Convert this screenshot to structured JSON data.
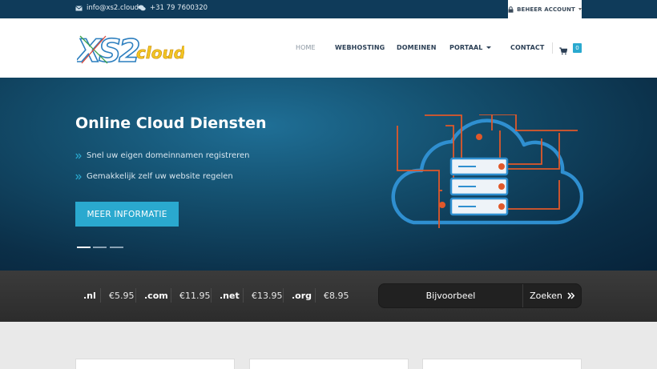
{
  "topbar": {
    "email": "info@xs2.cloud",
    "phone": "+31 79 7600320",
    "account_label": "BEHEER ACCOUNT"
  },
  "logo": {
    "text_main": "XS2",
    "text_sub": "cloud"
  },
  "nav": {
    "items": [
      {
        "label": "HOME",
        "active": true
      },
      {
        "label": "WEBHOSTING"
      },
      {
        "label": "DOMEINEN"
      },
      {
        "label": "PORTAAL",
        "has_dropdown": true
      },
      {
        "label": "CONTACT"
      }
    ],
    "cart_count": "0"
  },
  "hero": {
    "title": "Online Cloud Diensten",
    "bullets": [
      "Snel uw eigen domeinnamen registreren",
      "Gemakkelijk zelf uw website regelen"
    ],
    "cta_label": "MEER INFORMATIE",
    "slide_count": 3,
    "active_slide": 1
  },
  "domains": {
    "tlds": [
      {
        "tld": ".nl",
        "price": "€5.95"
      },
      {
        "tld": ".com",
        "price": "€11.95"
      },
      {
        "tld": ".net",
        "price": "€13.95"
      },
      {
        "tld": ".org",
        "price": "€8.95"
      }
    ],
    "search_placeholder": "Bijvoorbeel",
    "search_button": "Zoeken"
  },
  "colors": {
    "accent": "#2aa9cf",
    "topbar": "#0f3b5a",
    "illustration_orange": "#e0582a",
    "illustration_blue": "#2f8fd0"
  }
}
